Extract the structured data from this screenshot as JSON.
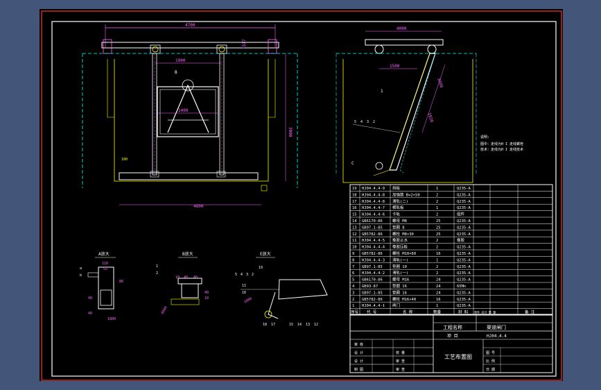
{
  "colors": {
    "outer": "#435578",
    "sheet": "#000000",
    "white": "#ffffff",
    "cyan": "#00ffff",
    "magenta": "#ff66ff",
    "yellow": "#ffff00",
    "red": "#ff3333"
  },
  "front_view": {
    "dim_top": "4700",
    "dim_mid": "1900",
    "dim_right": "1517",
    "dim_height": "3000",
    "dim_inner": "1400",
    "dim_bottom": "4800",
    "callout_b": "B"
  },
  "side_view": {
    "dim_top": "4000",
    "dim_offset": "1500",
    "dim_len1": "3400",
    "dim_len2": "1920",
    "callout_c": "C",
    "part_nums": [
      "1",
      "5",
      "4",
      "3",
      "2"
    ],
    "notes": [
      "说明:",
      "图中：走线为H I 走线螺栓",
      "技术：走线为H I 走线技术"
    ]
  },
  "details": [
    {
      "title": "A放大",
      "dims": [
        "110",
        "55",
        "88",
        "40",
        "40",
        "1800"
      ],
      "marks": [
        "a",
        "b"
      ]
    },
    {
      "title": "B放大",
      "dims": [
        "10",
        "40",
        "40",
        "10",
        "40",
        "4000"
      ],
      "marks": [
        "1",
        "2"
      ]
    },
    {
      "title": "E放大",
      "dims": [
        "5",
        "4",
        "3",
        "2",
        "19",
        "11",
        "16",
        "18",
        "17",
        "15",
        "14",
        "13",
        "12",
        "1800"
      ],
      "marks": []
    }
  ],
  "bom": {
    "rows": [
      [
        "19",
        "HJ04.4.4-9",
        "挡板",
        "1",
        "Q235-A"
      ],
      [
        "18",
        "HJ04.4.4-8",
        "加强筋 B=2×50",
        "2",
        "Q235-A"
      ],
      [
        "17",
        "HJ04.4.4-8",
        "滑轨(二)",
        "2",
        "Q235-A"
      ],
      [
        "16",
        "HJ04.4.4-7",
        "横轨板",
        "1",
        "Q235-A"
      ],
      [
        "15",
        "HJ04.4.4-6",
        "卡轨",
        "2",
        "组件"
      ],
      [
        "14",
        "GB6170-86",
        "螺母 M8",
        "25",
        "Q235-A"
      ],
      [
        "13",
        "GB97.1-85",
        "垫圈 8",
        "25",
        "Q235-A"
      ],
      [
        "12",
        "GB5782-86",
        "螺栓 M8×30",
        "25",
        "Q235-A"
      ],
      [
        "11",
        "HJ04.4.4-5",
        "橡胶止水",
        "2",
        "橡胶"
      ],
      [
        "10",
        "HJ04.4.4-4",
        "橡胶压板",
        "2",
        "Q235-A"
      ],
      [
        "9",
        "GB5782-86",
        "螺栓 M10×60",
        "16",
        "Q235-A"
      ],
      [
        "8",
        "HJ04.4.4-3",
        "滑轨(一)",
        "1",
        "Q235-A"
      ],
      [
        "7",
        "GB97.1-85",
        "垫圈 10",
        "2",
        "Q235-A"
      ],
      [
        "6",
        "HJ04.4.4-2",
        "滑轨(一)",
        "2",
        "Q235-A"
      ],
      [
        "5",
        "GB6170-86",
        "螺母 M16",
        "24",
        "Q235-A"
      ],
      [
        "4",
        "GB93-87",
        "垫圈 16",
        "24",
        "65Mn"
      ],
      [
        "3",
        "GB97.1-85",
        "垫圈 16",
        "24",
        "Q235-A"
      ],
      [
        "2",
        "GB5782-86",
        "螺栓 M16×40",
        "16",
        "Q235-A"
      ],
      [
        "1",
        "HJ04.4.4-1",
        "闸门",
        "1",
        "Q235-A"
      ]
    ],
    "header": [
      "序号",
      "代 号",
      "名 称",
      "数量",
      "材 料",
      "单件 总计 重 量",
      "备 注"
    ]
  },
  "title_block": {
    "project_label": "工程名称",
    "project_value": "渠道闸门",
    "item_label": "项  目",
    "item_value": "HJ04.4.4",
    "drawing_name": "工艺布置图",
    "sign_rows": [
      [
        "审 核",
        "",
        ""
      ],
      [
        "设 计",
        "校 量",
        ""
      ],
      [
        "设 计",
        "审 查",
        ""
      ],
      [
        "制 图",
        "审 查",
        ""
      ]
    ],
    "right_labels": [
      "图 号",
      "比 例",
      "日 期"
    ]
  }
}
